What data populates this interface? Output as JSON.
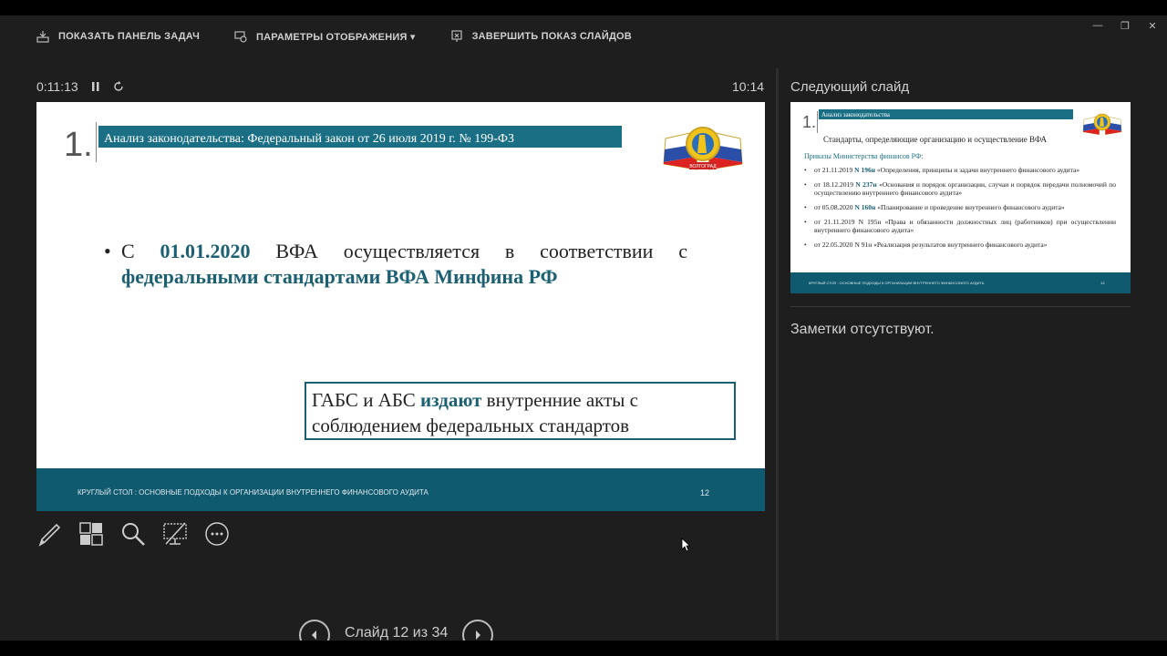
{
  "toolbar": {
    "taskbar_label": "ПОКАЗАТЬ ПАНЕЛЬ ЗАДАЧ",
    "display_settings_label": "ПАРАМЕТРЫ ОТОБРАЖЕНИЯ ▾",
    "end_show_label": "ЗАВЕРШИТЬ ПОКАЗ СЛАЙДОВ"
  },
  "timer": {
    "elapsed": "0:11:13",
    "clock": "10:14"
  },
  "slide": {
    "number": "1.",
    "title": "Анализ законодательства: Федеральный закон от 26 июля 2019 г. № 199-ФЗ",
    "bullet_part1": "С ",
    "bullet_date": "01.01.2020",
    "bullet_part2": " ВФА осуществляется в соответствии с ",
    "bullet_highlight": "федеральными стандартами ВФА Минфина РФ",
    "box_part1": "ГАБС и АБС ",
    "box_highlight": "издают",
    "box_part2": " внутренние акты с соблюдением федеральных стандартов",
    "footer_text": "КРУГЛЫЙ СТОЛ : ОСНОВНЫЕ ПОДХОДЫ К ОРГАНИЗАЦИИ ВНУТРЕННЕГО ФИНАНСОВОГО АУДИТА",
    "footer_page": "12",
    "logo_caption": "ВОЛГОГРАД"
  },
  "next": {
    "label": "Следующий слайд",
    "number": "1.",
    "title": "Анализ законодательства",
    "subtitle": "Стандарты, определяющие организацию и осуществление ВФА",
    "heading": "Приказы Министерства финансов РФ:",
    "items": [
      {
        "pre": "от 21.11.2019 ",
        "num": "N 196н",
        "text": " «Определения, принципы и задачи внутреннего финансового аудита»"
      },
      {
        "pre": "от 18.12.2019 ",
        "num": "N 237н",
        "text": " «Основания и порядок организации, случаи и порядок передачи полномочий по осуществлению внутреннего финансового аудита»"
      },
      {
        "pre": "от 05.08.2020 ",
        "num": "N 160н",
        "text": " «Планирование и проведение внутреннего финансового аудита»"
      },
      {
        "pre": "от 21.11.2019 ",
        "num": "N 195н",
        "text": " «Права и обязанности должностных лиц (работников) при осуществлении внутреннего финансового аудита»"
      },
      {
        "pre": "от 22.05.2020 ",
        "num": "N 91н",
        "text": " «Реализация результатов внутреннего финансового аудита»"
      }
    ],
    "footer_text": "КРУГЛЫЙ СТОЛ : ОСНОВНЫЕ ПОДХОДЫ К ОРГАНИЗАЦИИ ВНУТРЕННЕГО ФИНАНСОВОГО АУДИТА",
    "footer_page": "13"
  },
  "notes": {
    "text": "Заметки отсутствуют."
  },
  "nav": {
    "label": "Слайд 12 из 34"
  },
  "colors": {
    "accent": "#1b6f84",
    "footer": "#0f5a6f",
    "background": "#1e1e1e"
  }
}
